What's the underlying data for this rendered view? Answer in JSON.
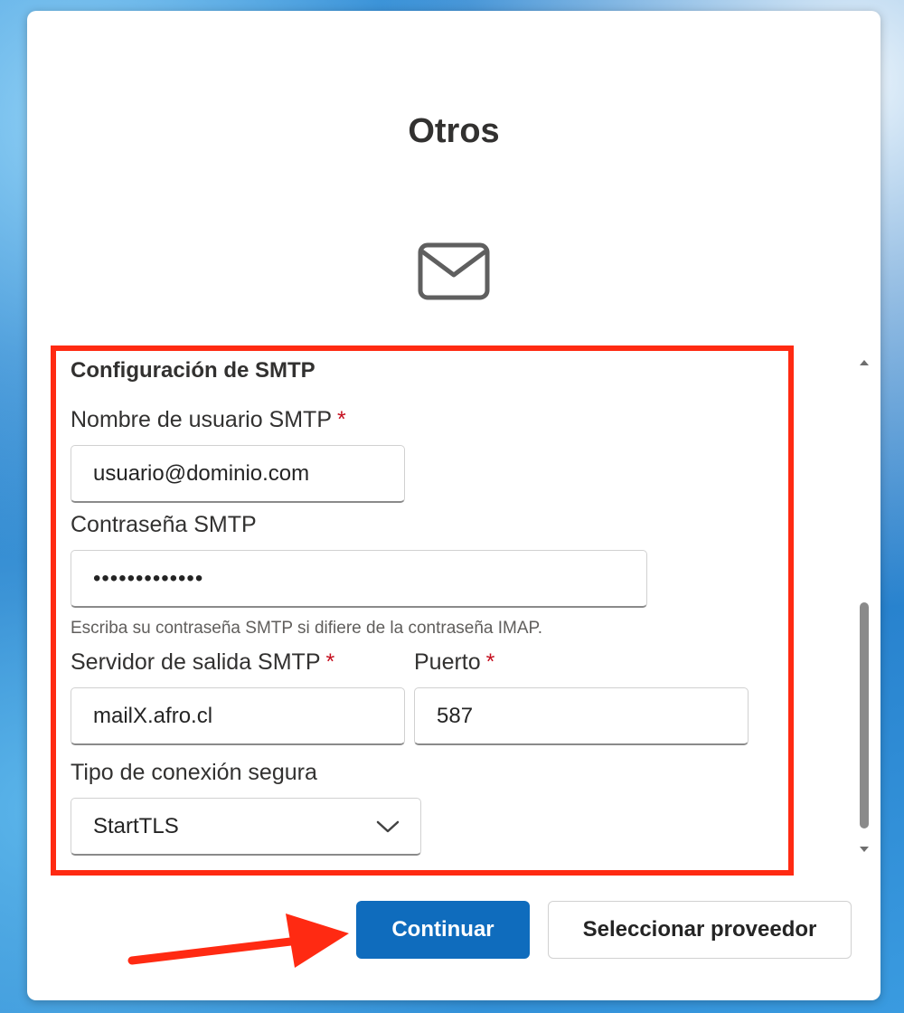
{
  "dialog": {
    "title": "Otros",
    "icon": "mail-icon"
  },
  "smtp": {
    "section_title": "Configuración de SMTP",
    "username": {
      "label": "Nombre de usuario SMTP",
      "required": "*",
      "value": "usuario@dominio.com"
    },
    "password": {
      "label": "Contraseña SMTP",
      "value": "•••••••••••••",
      "hint": "Escriba su contraseña SMTP si difiere de la contraseña IMAP."
    },
    "server": {
      "label": "Servidor de salida SMTP",
      "required": "*",
      "value": "mailX.afro.cl"
    },
    "port": {
      "label": "Puerto",
      "required": "*",
      "value": "587"
    },
    "security": {
      "label": "Tipo de conexión segura",
      "value": "StartTLS"
    }
  },
  "buttons": {
    "continue": "Continuar",
    "select_provider": "Seleccionar proveedor"
  },
  "colors": {
    "accent": "#0f6cbd",
    "highlight": "#ff2a12",
    "required": "#c50f1f"
  }
}
